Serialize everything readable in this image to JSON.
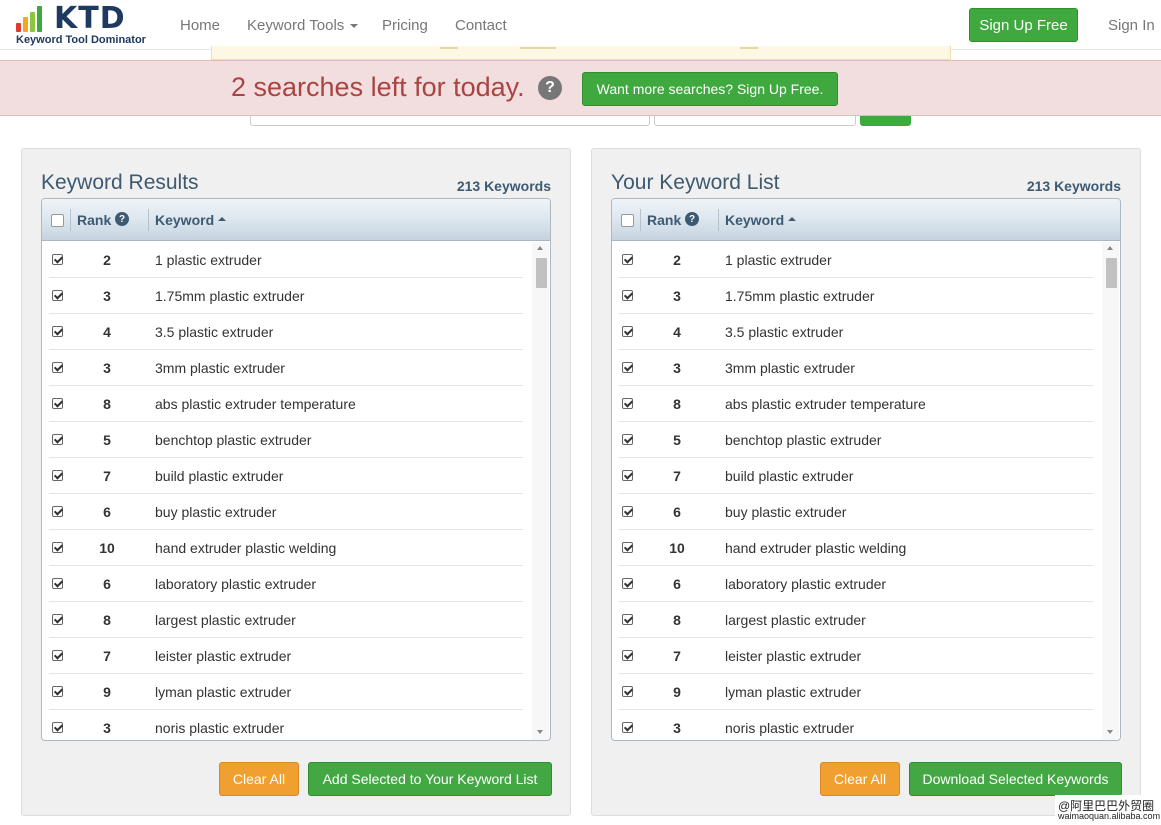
{
  "colors": {
    "brand_navy": "#1f3a60",
    "green": "#3fa83f",
    "orange": "#f0a030",
    "alert_text": "#a94442",
    "alert_bg": "#f2dede"
  },
  "header": {
    "logo_text": "KTD",
    "logo_subtitle": "Keyword Tool Dominator",
    "nav": {
      "home": "Home",
      "keyword_tools": "Keyword Tools",
      "pricing": "Pricing",
      "contact": "Contact"
    },
    "signup_label": "Sign Up Free",
    "signin_label": "Sign In"
  },
  "banner": {
    "message": "2 searches left for today.",
    "help_glyph": "?",
    "cta_label": "Want more searches? Sign Up Free."
  },
  "results_panel": {
    "title": "Keyword Results",
    "count": "213 Keywords",
    "col_rank": "Rank",
    "col_keyword": "Keyword",
    "clear_label": "Clear All",
    "action_label": "Add Selected to Your Keyword List"
  },
  "list_panel": {
    "title": "Your Keyword List",
    "count": "213 Keywords",
    "col_rank": "Rank",
    "col_keyword": "Keyword",
    "clear_label": "Clear All",
    "action_label": "Download Selected Keywords"
  },
  "rows": [
    {
      "rank": "2",
      "keyword": "1 plastic extruder",
      "checked": true
    },
    {
      "rank": "3",
      "keyword": "1.75mm plastic extruder",
      "checked": true
    },
    {
      "rank": "4",
      "keyword": "3.5 plastic extruder",
      "checked": true
    },
    {
      "rank": "3",
      "keyword": "3mm plastic extruder",
      "checked": true
    },
    {
      "rank": "8",
      "keyword": "abs plastic extruder temperature",
      "checked": true
    },
    {
      "rank": "5",
      "keyword": "benchtop plastic extruder",
      "checked": true
    },
    {
      "rank": "7",
      "keyword": "build plastic extruder",
      "checked": true
    },
    {
      "rank": "6",
      "keyword": "buy plastic extruder",
      "checked": true
    },
    {
      "rank": "10",
      "keyword": "hand extruder plastic welding",
      "checked": true
    },
    {
      "rank": "6",
      "keyword": "laboratory plastic extruder",
      "checked": true
    },
    {
      "rank": "8",
      "keyword": "largest plastic extruder",
      "checked": true
    },
    {
      "rank": "7",
      "keyword": "leister plastic extruder",
      "checked": true
    },
    {
      "rank": "9",
      "keyword": "lyman plastic extruder",
      "checked": true
    },
    {
      "rank": "3",
      "keyword": "noris plastic extruder",
      "checked": true
    }
  ],
  "watermark": {
    "line1": "@阿里巴巴外贸圈",
    "line2": "waimaoquan.alibaba.com"
  }
}
